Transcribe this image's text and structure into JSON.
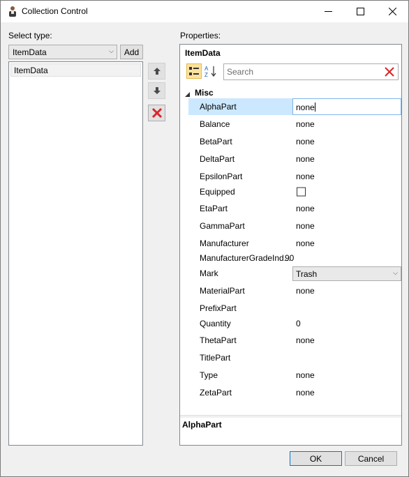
{
  "window": {
    "title": "Collection Control",
    "icon": "person-icon"
  },
  "left": {
    "select_type_label": "Select type:",
    "type_combo_value": "ItemData",
    "add_label": "Add",
    "list_items": [
      "ItemData"
    ]
  },
  "right": {
    "properties_label": "Properties:",
    "object_name": "ItemData",
    "search_placeholder": "Search",
    "category": "Misc",
    "selected_property_description": "AlphaPart",
    "properties": [
      {
        "name": "AlphaPart",
        "value": "none"
      },
      {
        "name": "Balance",
        "value": "none"
      },
      {
        "name": "BetaPart",
        "value": "none"
      },
      {
        "name": "DeltaPart",
        "value": "none"
      },
      {
        "name": "EpsilonPart",
        "value": "none"
      },
      {
        "name": "Equipped",
        "value": ""
      },
      {
        "name": "EtaPart",
        "value": "none"
      },
      {
        "name": "GammaPart",
        "value": "none"
      },
      {
        "name": "Manufacturer",
        "value": "none"
      },
      {
        "name": "ManufacturerGradeInd...",
        "value": "90"
      },
      {
        "name": "Mark",
        "value": "Trash"
      },
      {
        "name": "MaterialPart",
        "value": "none"
      },
      {
        "name": "PrefixPart",
        "value": ""
      },
      {
        "name": "Quantity",
        "value": "0"
      },
      {
        "name": "ThetaPart",
        "value": "none"
      },
      {
        "name": "TitlePart",
        "value": ""
      },
      {
        "name": "Type",
        "value": "none"
      },
      {
        "name": "ZetaPart",
        "value": "none"
      }
    ]
  },
  "footer": {
    "ok_label": "OK",
    "cancel_label": "Cancel"
  },
  "colors": {
    "selection": "#cce8ff",
    "accent": "#0078d7",
    "delete_red": "#d9262b"
  }
}
